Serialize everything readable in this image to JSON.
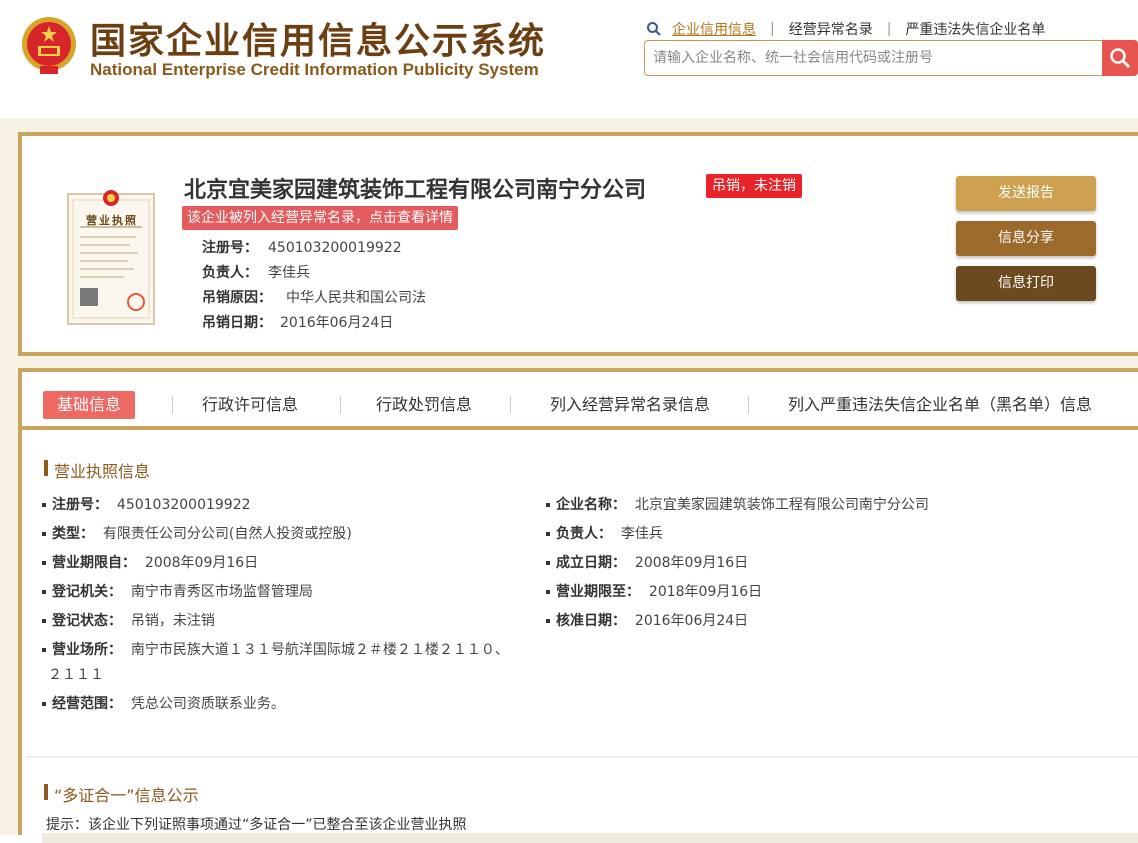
{
  "header": {
    "title_cn": "国家企业信用信息公示系统",
    "title_en": "National Enterprise Credit Information Publicity System",
    "nav": [
      "企业信用信息",
      "经营异常名录",
      "严重违法失信企业名单"
    ],
    "search_placeholder": "请输入企业名称、统一社会信用代码或注册号"
  },
  "company": {
    "name": "北京宜美家园建筑装饰工程有限公司南宁分公司",
    "status_badge": "吊销，未注销",
    "abnormal_notice": "该企业被列入经营异常名录，点击查看详情",
    "rows": [
      {
        "label": "注册号：",
        "value": "450103200019922"
      },
      {
        "label": "负责人：",
        "value": "李佳兵"
      },
      {
        "label": "吊销原因：",
        "value": "中华人民共和国公司法"
      },
      {
        "label": "吊销日期：",
        "value": "2016年06月24日"
      }
    ],
    "buttons": {
      "send": "发送报告",
      "share": "信息分享",
      "print": "信息打印"
    },
    "license_thumb_text": "营业执照"
  },
  "tabs": [
    "基础信息",
    "行政许可信息",
    "行政处罚信息",
    "列入经营异常名录信息",
    "列入严重违法失信企业名单（黑名单）信息"
  ],
  "basic": {
    "section_title": "营业执照信息",
    "left": [
      {
        "label": "注册号：",
        "value": "450103200019922"
      },
      {
        "label": "类型：",
        "value": "有限责任公司分公司(自然人投资或控股)"
      },
      {
        "label": "营业期限自：",
        "value": "2008年09月16日"
      },
      {
        "label": "登记机关：",
        "value": "南宁市青秀区市场监督管理局"
      },
      {
        "label": "登记状态：",
        "value": "吊销，未注销"
      }
    ],
    "right": [
      {
        "label": "企业名称：",
        "value": "北京宜美家园建筑装饰工程有限公司南宁分公司"
      },
      {
        "label": "负责人：",
        "value": "李佳兵"
      },
      {
        "label": "成立日期：",
        "value": "2008年09月16日"
      },
      {
        "label": "营业期限至：",
        "value": "2018年09月16日"
      },
      {
        "label": "核准日期：",
        "value": "2016年06月24日"
      }
    ],
    "address_label": "营业场所：",
    "address_value_1": "南宁市民族大道１３１号航洋国际城２＃楼２１楼２１１０、",
    "address_value_2": "２１１１",
    "scope_label": "经营范围：",
    "scope_value": "凭总公司资质联系业务。"
  },
  "multi": {
    "section_title": "“多证合一”信息公示",
    "hint": "提示：该企业下列证照事项通过“多证合一”已整合至该企业营业执照"
  },
  "colors": {
    "accent_gold": "#c9a45c",
    "brand_brown": "#6b3f12",
    "red": "#e8242a"
  }
}
